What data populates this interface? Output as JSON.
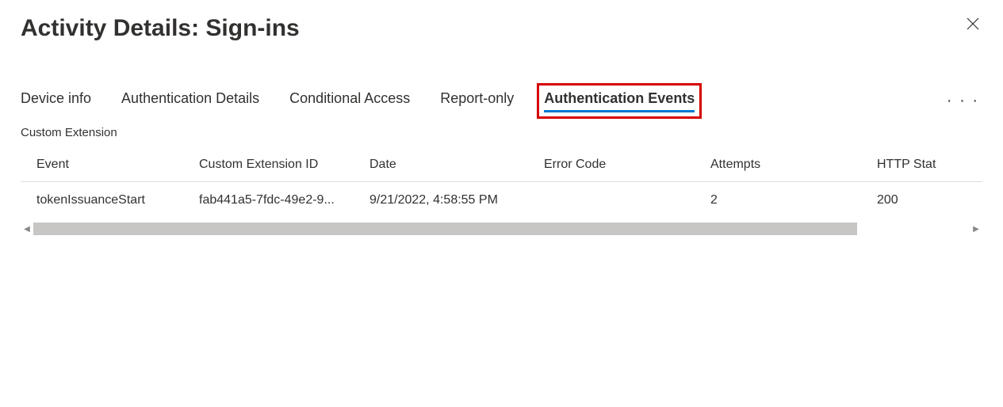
{
  "title": "Activity Details: Sign-ins",
  "tabs": [
    {
      "label": "Device info",
      "active": false
    },
    {
      "label": "Authentication Details",
      "active": false
    },
    {
      "label": "Conditional Access",
      "active": false
    },
    {
      "label": "Report-only",
      "active": false
    },
    {
      "label": "Authentication Events",
      "active": true,
      "highlighted": true
    }
  ],
  "section_label": "Custom Extension",
  "columns": {
    "event": "Event",
    "extid": "Custom Extension ID",
    "date": "Date",
    "error": "Error Code",
    "attempts": "Attempts",
    "http": "HTTP Stat"
  },
  "rows": [
    {
      "event": "tokenIssuanceStart",
      "extid": "fab441a5-7fdc-49e2-9...",
      "date": "9/21/2022, 4:58:55 PM",
      "error": "",
      "attempts": "2",
      "http": "200"
    }
  ],
  "more_label": "· · ·"
}
